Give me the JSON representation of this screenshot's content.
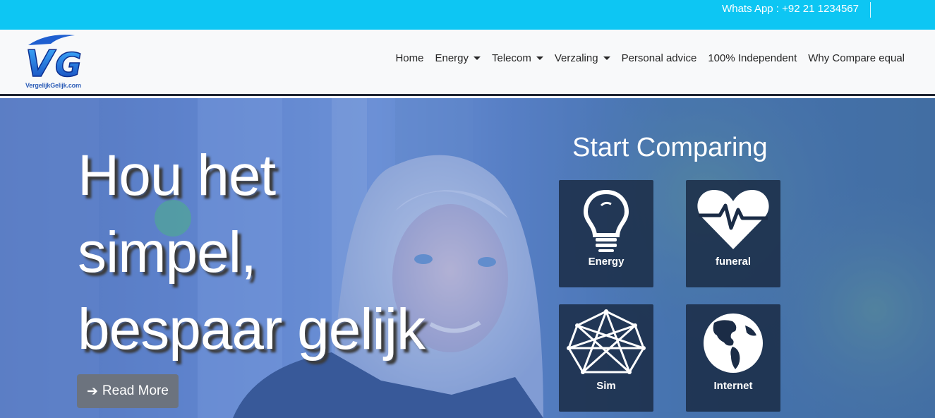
{
  "topbar": {
    "whatsapp": "Whats App : +92 21 1234567"
  },
  "brand": {
    "logo_letters": "VG",
    "name": "VergelijkGelijk.com"
  },
  "nav": [
    {
      "label": "Home",
      "dropdown": false
    },
    {
      "label": "Energy",
      "dropdown": true
    },
    {
      "label": "Telecom",
      "dropdown": true
    },
    {
      "label": "Verzaling",
      "dropdown": true
    },
    {
      "label": "Personal advice",
      "dropdown": false
    },
    {
      "label": "100% Independent",
      "dropdown": false
    },
    {
      "label": "Why Compare equal",
      "dropdown": false
    }
  ],
  "hero": {
    "title_lines": [
      "Hou het",
      "simpel,",
      "bespaar gelijk"
    ],
    "read_more": "Read More"
  },
  "compare": {
    "title": "Start Comparing",
    "tiles": [
      {
        "label": "Energy",
        "icon": "lightbulb-icon"
      },
      {
        "label": "funeral",
        "icon": "heart-pulse-icon"
      },
      {
        "label": "Sim",
        "icon": "sim-network-icon"
      },
      {
        "label": "Internet",
        "icon": "globe-icon"
      }
    ]
  },
  "colors": {
    "topbar": "#0dc6f3",
    "navbar": "#f8f9fa",
    "tile": "#1b2c46",
    "button": "#6c737e"
  }
}
